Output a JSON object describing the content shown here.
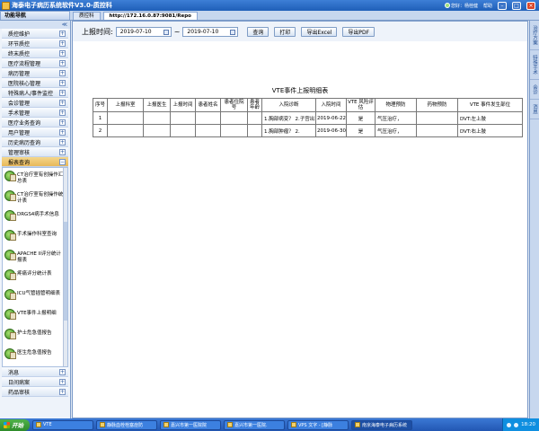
{
  "window": {
    "title": "海泰电子病历系统软件V3.0-质控科",
    "user_info": "您好：杨桂健",
    "help_label": "帮助"
  },
  "tabs": {
    "nav_title": "功能导航",
    "items": [
      {
        "label": "质控科",
        "active": false
      },
      {
        "label": "http://172.16.0.87:9081/Repo",
        "active": true
      }
    ]
  },
  "sidebar": {
    "menu_top": [
      "质控维护",
      "环节质控",
      "终末质控",
      "医疗流程管理",
      "病历管理",
      "医院核心管理",
      "特殊病人/事件监控",
      "会诊管理",
      "手术管理",
      "医疗业务查询",
      "用户管理",
      "历史病历查询",
      "管理审核"
    ],
    "expanded_menu": "报表查询",
    "sub_items": [
      "CT治疗室有创操作汇总表",
      "CT治疗室有创操作统计表",
      "DRGS4病手术信息",
      "手术操作科室查询",
      "APACHE II评分统计报表",
      "疼痛评分统计表",
      "ICU气管插管明细表",
      "VTE事件上报明细",
      "护士危急值报告",
      "医生危急值报告"
    ],
    "menu_bottom": [
      "消息",
      "日间病案",
      "药品审核"
    ]
  },
  "toolbar": {
    "date_label": "上报时间:",
    "date_from": "2019-07-10",
    "date_to": "2019-07-10",
    "tilde": "~",
    "query_label": "查询",
    "print_label": "打印",
    "export_excel_label": "导出Excel",
    "export_pdf_label": "导出PDF"
  },
  "report": {
    "title": "VTE事件上报明细表",
    "columns": [
      "序号",
      "上报科室",
      "上报医生",
      "上报时间",
      "患者姓名",
      "患者住院号",
      "患者年龄",
      "入院诊断",
      "入院时间",
      "VTE 风险评估",
      "物理预防",
      "药物预防",
      "VTE 事件发生部位"
    ],
    "rows": [
      [
        "1",
        "",
        "",
        "",
        "",
        "",
        "",
        "1.胸部病变？ 2.子宫出",
        "2019-06-22",
        "是",
        "气压治疗，",
        "",
        "DVT:左上肢"
      ],
      [
        "2",
        "",
        "",
        "",
        "",
        "",
        "",
        "1.胸部肿瘤？ 2.",
        "2019-06-30",
        "是",
        "气压治疗，",
        "",
        "DVT:右上肢"
      ]
    ]
  },
  "right_panel": [
    "治疗方案",
    "特殊手术",
    "会诊",
    "消息"
  ],
  "taskbar": {
    "start_label": "开始",
    "tasks": [
      {
        "label": "VTE",
        "active": false
      },
      {
        "label": "静脉血栓栓塞症防",
        "active": false
      },
      {
        "label": "嘉兴市第一医院院",
        "active": false
      },
      {
        "label": "嘉兴市第一医院.",
        "active": false
      },
      {
        "label": "VPS 文字 - [静脉",
        "active": false
      },
      {
        "label": "南京海泰电子病历系统",
        "active": true
      }
    ],
    "clock": "18:20"
  }
}
